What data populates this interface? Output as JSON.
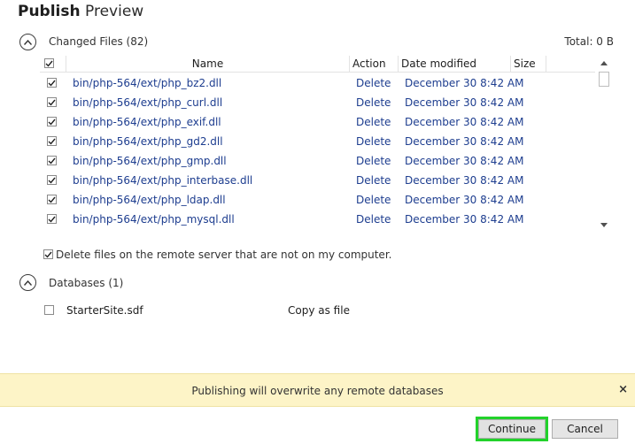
{
  "title": {
    "bold": "Publish",
    "light": "Preview"
  },
  "changed_files": {
    "label": "Changed Files (82)",
    "total": "Total: 0 B",
    "columns": {
      "name": "Name",
      "action": "Action",
      "date": "Date modified",
      "size": "Size"
    },
    "rows": [
      {
        "name": "bin/php-564/ext/php_bz2.dll",
        "action": "Delete",
        "date": "December 30 8:42 AM"
      },
      {
        "name": "bin/php-564/ext/php_curl.dll",
        "action": "Delete",
        "date": "December 30 8:42 AM"
      },
      {
        "name": "bin/php-564/ext/php_exif.dll",
        "action": "Delete",
        "date": "December 30 8:42 AM"
      },
      {
        "name": "bin/php-564/ext/php_gd2.dll",
        "action": "Delete",
        "date": "December 30 8:42 AM"
      },
      {
        "name": "bin/php-564/ext/php_gmp.dll",
        "action": "Delete",
        "date": "December 30 8:42 AM"
      },
      {
        "name": "bin/php-564/ext/php_interbase.dll",
        "action": "Delete",
        "date": "December 30 8:42 AM"
      },
      {
        "name": "bin/php-564/ext/php_ldap.dll",
        "action": "Delete",
        "date": "December 30 8:42 AM"
      },
      {
        "name": "bin/php-564/ext/php_mysql.dll",
        "action": "Delete",
        "date": "December 30 8:42 AM"
      }
    ]
  },
  "delete_option": {
    "label": "Delete files on the remote server that are not on my computer."
  },
  "databases": {
    "label": "Databases (1)",
    "items": [
      {
        "name": "StarterSite.sdf",
        "action": "Copy as file"
      }
    ]
  },
  "warning": {
    "text": "Publishing will overwrite any remote databases",
    "close": "×"
  },
  "buttons": {
    "continue": "Continue",
    "cancel": "Cancel"
  }
}
